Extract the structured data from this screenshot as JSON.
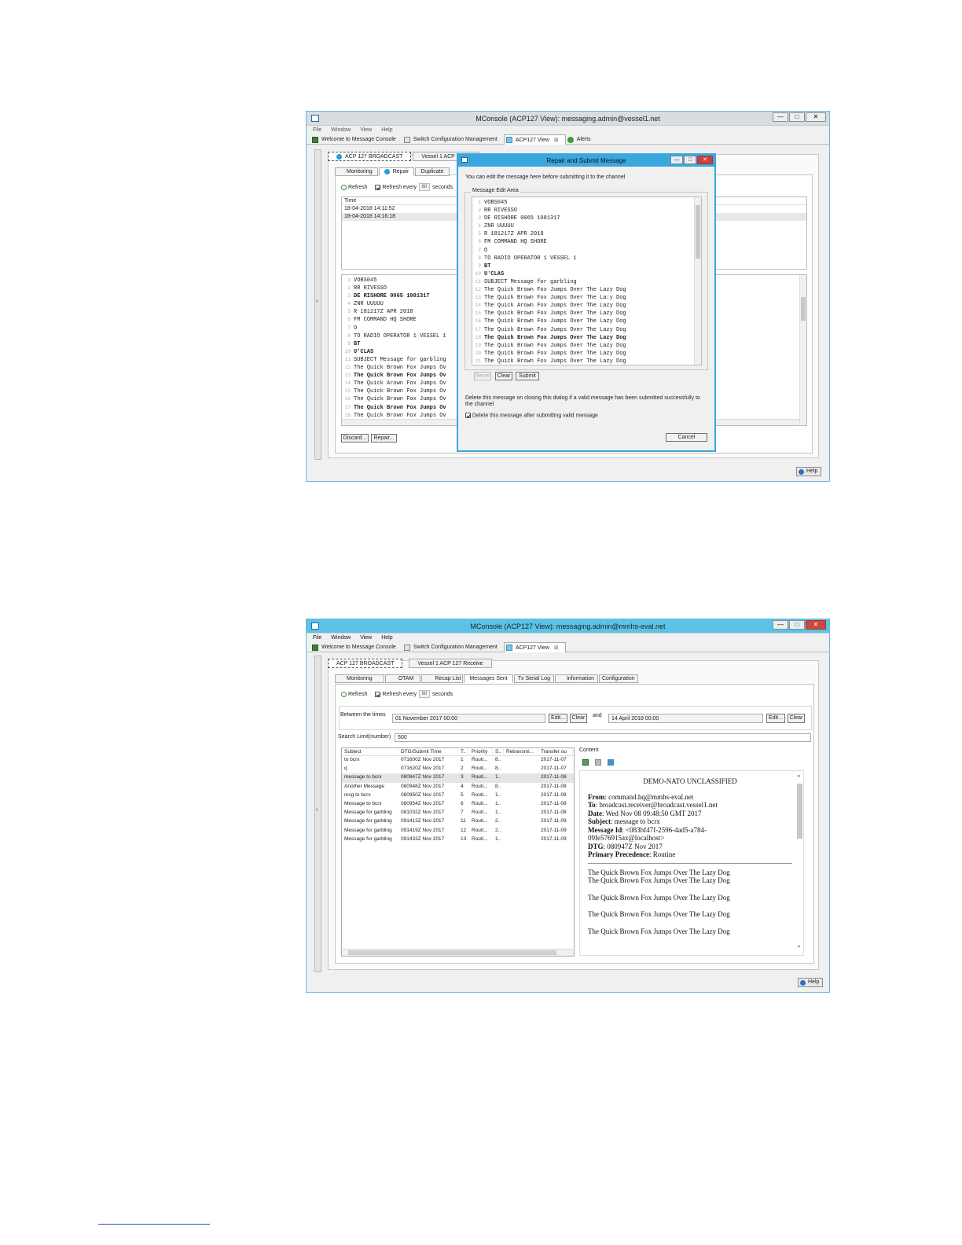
{
  "screen1": {
    "title": "MConsole (ACP127 View): messaging.admin@vessel1.net",
    "menu": [
      "File",
      "Window",
      "View",
      "Help"
    ],
    "window_tabs": [
      "Welcome to Message Console",
      "Switch Configuration Management",
      "ACP127 View",
      "Alerts"
    ],
    "panel_tabs": [
      "ACP 127 BROADCAST",
      "Vessel 1 ACP 127 S"
    ],
    "sub_tabs": [
      "Monitoring",
      "Repair",
      "Duplicate"
    ],
    "refresh_label": "Refresh",
    "refresh_every_label": "Refresh every",
    "refresh_value": "60",
    "seconds_label": "seconds",
    "time_header": "Time",
    "times": [
      "18-04-2018 14:11:52",
      "18-04-2018 14:16:18"
    ],
    "message_lines": [
      "VOBS045",
      "RR RIVESSO",
      "DE RISHORE 0065 1081317",
      "ZNR UUUUU",
      "R 181217Z APR 2018",
      "FM COMMAND HQ SHORE",
      "O",
      "TO RADIO OPERATOR 1 VESSEL 1",
      "BT",
      "U'CLAS",
      "SUBJECT Message for garbling",
      "The Quick Brown Fox Jumps Ov",
      "The Quick Brown Fox Jumps Ov",
      "The Quick Arown Fox Jumps Ov",
      "The Quick Brown Fox Jumps Ov",
      "The Quick Brown Fox Jumps Ov",
      "The Quick Brown Fox Jumps Ov",
      "The Quick Brown Fox Jumps Ov"
    ],
    "discard_label": "Discard...",
    "repair_label": "Repair...",
    "help_label": "Help",
    "dialog": {
      "title": "Repair and Submit Message",
      "instruction": "You can edit the message here before submitting it to the channel",
      "group_label": "Message Edit Area",
      "lines": [
        "VOBS045",
        "RR RIVESSO",
        "DE RISHORE 0065 1081317",
        "ZNR UUUUU",
        "R 181217Z APR 2018",
        "FM COMMAND HQ SHORE",
        "O",
        "TO RADIO OPERATOR 1 VESSEL 1",
        "BT",
        "U'CLAS",
        "SUBJECT Message for garbling",
        "The Quick Brown Fox Jumps Over The Lazy Dog",
        "The Quick Brown Fox Jumps Over The La:y Dog",
        "The Quick Arown Fox Jumps Over The Lazy Dog",
        "The Quick Brown Fox Jumps Over The Lazy Dog",
        "The Quick Brown Fox Jumps Over The Lazy Dog",
        "The Quick Brown Fox Jumps Over The Lazy Dog",
        "The Quick Brown Fox Jumps Over The Lazy Dog",
        "The Quick Brown Fox Jumps Over The Lazy Dog",
        "The Quick Brown Fox Jumps Over The Lazy Dog",
        "The Quick Brown Fox Jumps Over The Lazy Dog"
      ],
      "reset_label": "Reset",
      "clear_label": "Clear",
      "submit_label": "Submit",
      "delete_note": "Delete this message on closing this dialog if a valid message has been submitted successfully to the channel",
      "delete_checkbox": "Delete this message after submitting valid message",
      "cancel_label": "Cancel"
    }
  },
  "screen2": {
    "title": "MConsole (ACP127 View): messaging.admin@mmhs-eval.net",
    "menu": [
      "File",
      "Window",
      "View",
      "Help"
    ],
    "window_tabs": [
      "Welcome to Message Console",
      "Switch Configuration Management",
      "ACP127 View"
    ],
    "panel_tabs": [
      "ACP 127 BROADCAST",
      "Vessel 1 ACP 127 Receive"
    ],
    "sub_tabs": [
      "Monitoring",
      "OTAM",
      "Recap List",
      "Messages Sent",
      "Tx Serial Log",
      "Information",
      "Configuration"
    ],
    "refresh_label": "Refresh",
    "refresh_every_label": "Refresh every",
    "refresh_value": "60",
    "seconds_label": "seconds",
    "between_label": "Between the times",
    "from_time": "01 November 2017 00:00",
    "and_label": "and",
    "to_time": "14 April 2018 00:00",
    "edit_label": "Edit...",
    "clear_label": "Clear",
    "search_limit_label": "Search Limit(number)",
    "search_limit_value": "500",
    "columns": [
      "Subject",
      "DTG/Submit Time",
      "T..",
      "Priority",
      "S..",
      "Retransmi...",
      "Transfer ou"
    ],
    "rows": [
      [
        "to bcrx",
        "071600Z Nov 2017",
        "1",
        "Routi...",
        "8..",
        "",
        "2017-11-07"
      ],
      [
        "q",
        "071620Z Nov 2017",
        "2",
        "Routi...",
        "8..",
        "",
        "2017-11-07"
      ],
      [
        "message to bcrx",
        "080947Z Nov 2017",
        "3",
        "Routi...",
        "1..",
        "",
        "2017-11-08"
      ],
      [
        "Another Message",
        "080948Z Nov 2017",
        "4",
        "Routi...",
        "8..",
        "",
        "2017-11-08"
      ],
      [
        "msg to bcrx",
        "080950Z Nov 2017",
        "5",
        "Routi...",
        "1..",
        "",
        "2017-11-08"
      ],
      [
        "Message to bcrx",
        "080954Z Nov 2017",
        "6",
        "Routi...",
        "1..",
        "",
        "2017-11-08"
      ],
      [
        "Message for garbling",
        "081032Z Nov 2017",
        "7",
        "Routi...",
        "1..",
        "",
        "2017-11-08"
      ],
      [
        "Message for garbling",
        "091413Z Nov 2017",
        "11",
        "Routi...",
        "2..",
        "",
        "2017-11-09"
      ],
      [
        "Message for garbling",
        "091419Z Nov 2017",
        "12",
        "Routi...",
        "2..",
        "",
        "2017-11-09"
      ],
      [
        "Message for garbling",
        "091433Z Nov 2017",
        "13",
        "Routi...",
        "1..",
        "",
        "2017-11-09"
      ]
    ],
    "content_label": "Content",
    "content": {
      "classification": "DEMO-NATO UNCLASSIFIED",
      "from_label": "From",
      "from_value": ": command.hq@mmhs-eval.net",
      "to_label": "To",
      "to_value": ": broadcast.receiver@broadcast.vessel1.net",
      "date_label": "Date",
      "date_value": ": Wed Nov 08 09:48:50 GMT 2017",
      "subject_label": "Subject",
      "subject_value": ": message to bcrx",
      "msgid_label": "Message Id",
      "msgid_value": ": <083bf47f-2596-4ad5-a784-",
      "msgid_cont": "09fe576915ax@localhost>",
      "dtg_label": "DTG",
      "dtg_value": ": 080947Z Nov 2017",
      "prec_label": "Primary Precedence",
      "prec_value": ": Routine",
      "body": [
        "The Quick Brown Fox Jumps Over The Lazy Dog",
        "The Quick Brown Fox Jumps Over The Lazy Dog",
        "The Quick Brown Fox Jumps Over The Lazy Dog",
        "The Quick Brown Fox Jumps Over The Lazy Dog",
        "The Quick Brown Fox Jumps Over The Lazy Dog"
      ]
    },
    "help_label": "Help"
  }
}
